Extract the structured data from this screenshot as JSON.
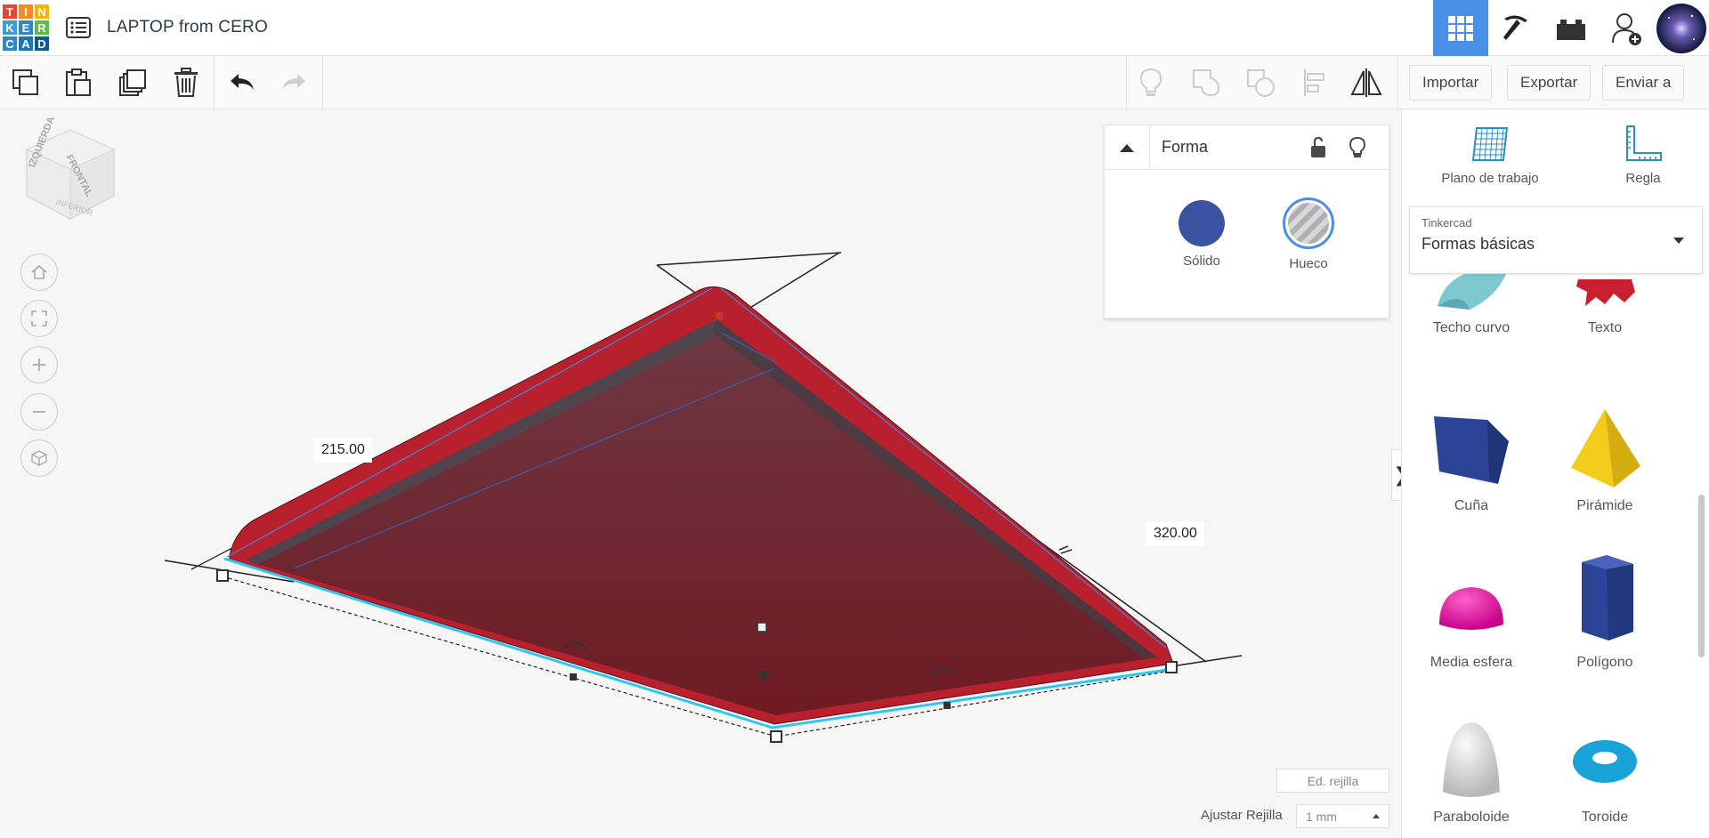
{
  "header": {
    "logo_letters": [
      "T",
      "I",
      "N",
      "K",
      "E",
      "R",
      "C",
      "A",
      "D"
    ],
    "logo_colors": [
      "#e8452c",
      "#f28c1e",
      "#f7b500",
      "#3b9dd8",
      "#2f87c7",
      "#62bb46",
      "#2f87c7",
      "#1a76bb",
      "#0a5a9a"
    ],
    "title": "LAPTOP from CERO",
    "active_color": "#4a8fe7"
  },
  "toolbar": {
    "left_icons": [
      "copy-icon",
      "paste-icon",
      "duplicate-icon",
      "delete-icon",
      "undo-icon",
      "redo-icon"
    ],
    "right_icons": [
      "lightbulb-icon",
      "group-icon",
      "ungroup-icon",
      "align-icon",
      "mirror-icon"
    ],
    "import_label": "Importar",
    "export_label": "Exportar",
    "send_label": "Enviar a"
  },
  "viewcube": {
    "left_face": "IZQUIERDA",
    "front_face": "FRONTAL",
    "bottom_face": "INFERIOR"
  },
  "dimensions": {
    "width_label": "215.00",
    "length_label": "320.00"
  },
  "shape_panel": {
    "title": "Forma",
    "solid_label": "Sólido",
    "hole_label": "Hueco",
    "solid_color": "#3b52a2"
  },
  "grid": {
    "edit_label": "Ed. rejilla",
    "snap_label": "Ajustar Rejilla",
    "snap_value": "1 mm"
  },
  "library": {
    "workplane_label": "Plano de trabajo",
    "ruler_label": "Regla",
    "provider_label": "Tinkercad",
    "category_label": "Formas básicas",
    "shapes": [
      {
        "label": "Techo curvo"
      },
      {
        "label": "Texto"
      },
      {
        "label": "Cuña"
      },
      {
        "label": "Pirámide"
      },
      {
        "label": "Media esfera"
      },
      {
        "label": "Polígono"
      },
      {
        "label": "Paraboloide"
      },
      {
        "label": "Toroide"
      }
    ]
  }
}
